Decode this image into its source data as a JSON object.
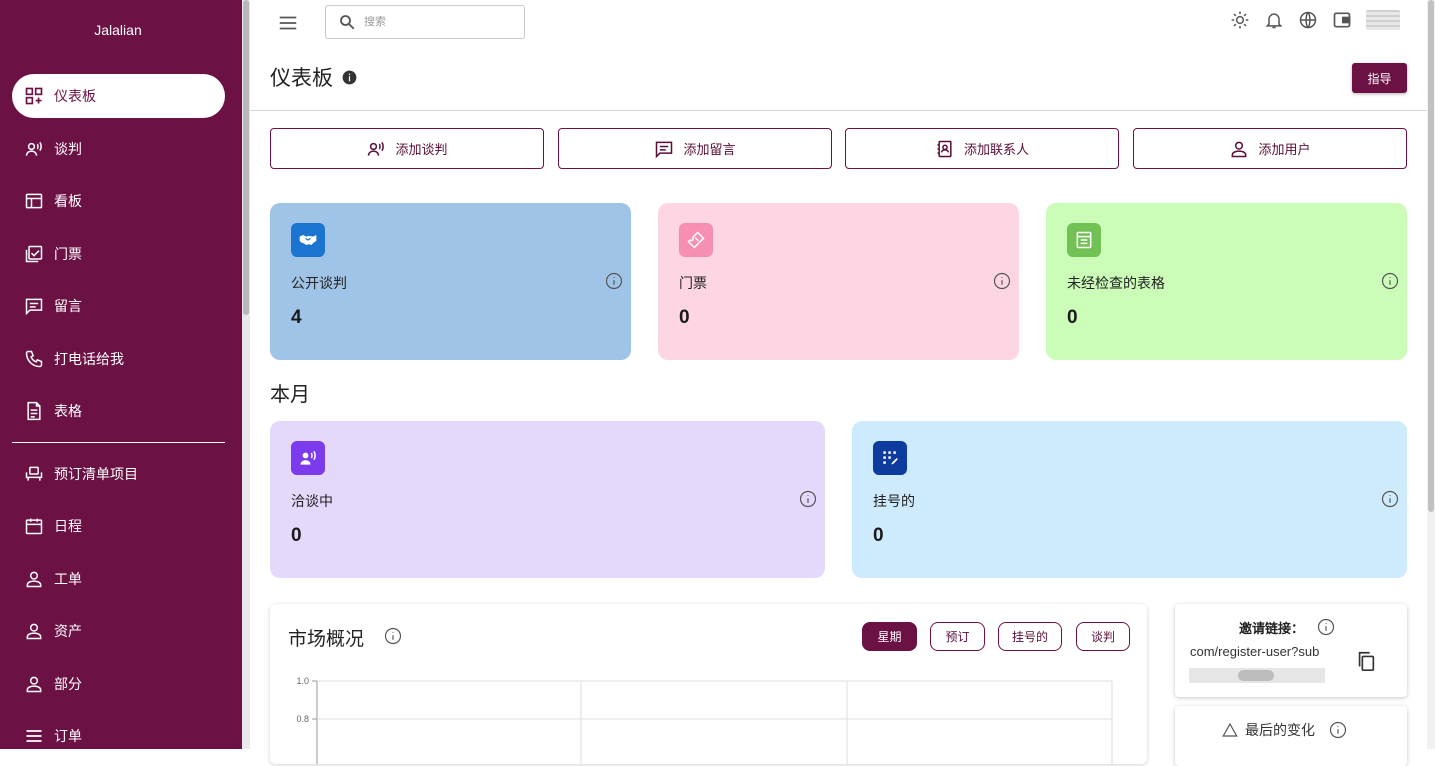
{
  "sidebar": {
    "brand": "Jalalian",
    "items": [
      {
        "label": "仪表板",
        "icon": "dashboard-icon"
      },
      {
        "label": "谈判",
        "icon": "voice-person-icon"
      },
      {
        "label": "看板",
        "icon": "board-icon"
      },
      {
        "label": "门票",
        "icon": "checklist-icon"
      },
      {
        "label": "留言",
        "icon": "message-icon"
      },
      {
        "label": "打电话给我",
        "icon": "phone-icon"
      },
      {
        "label": "表格",
        "icon": "document-icon"
      },
      {
        "label": "预订清单项目",
        "icon": "reservation-icon"
      },
      {
        "label": "日程",
        "icon": "calendar-icon"
      },
      {
        "label": "工单",
        "icon": "person-icon"
      },
      {
        "label": "资产",
        "icon": "person-icon"
      },
      {
        "label": "部分",
        "icon": "person-icon"
      },
      {
        "label": "订单",
        "icon": "list-icon"
      }
    ]
  },
  "topbar": {
    "search_placeholder": "搜索"
  },
  "header": {
    "title": "仪表板",
    "guide_label": "指导"
  },
  "quick_actions": [
    {
      "label": "添加谈判",
      "icon": "voice-person-icon"
    },
    {
      "label": "添加留言",
      "icon": "message-icon"
    },
    {
      "label": "添加联系人",
      "icon": "contact-icon"
    },
    {
      "label": "添加用户",
      "icon": "person-icon"
    }
  ],
  "stats": [
    {
      "label": "公开谈判",
      "value": "4",
      "bg": "#a0c4e7",
      "icon_bg": "#1b75d0",
      "icon": "handshake-icon"
    },
    {
      "label": "门票",
      "value": "0",
      "bg": "#fed6e3",
      "icon_bg": "#f78fb3",
      "icon": "ticket-icon"
    },
    {
      "label": "未经检查的表格",
      "value": "0",
      "bg": "#cbfdb9",
      "icon_bg": "#72c154",
      "icon": "form-icon"
    }
  ],
  "month": {
    "title": "本月",
    "stats": [
      {
        "label": "洽谈中",
        "value": "0",
        "bg": "#e5d9fb",
        "icon_bg": "#7c3aed",
        "icon": "voice-person-icon"
      },
      {
        "label": "挂号的",
        "value": "0",
        "bg": "#cdebfd",
        "icon_bg": "#0d3b9e",
        "icon": "dialpad-icon"
      }
    ]
  },
  "market": {
    "title": "市场概况",
    "tabs": [
      {
        "label": "星期",
        "active": true
      },
      {
        "label": "预订",
        "active": false
      },
      {
        "label": "挂号的",
        "active": false
      },
      {
        "label": "谈判",
        "active": false
      }
    ]
  },
  "chart_data": {
    "type": "line",
    "categories": [],
    "series": [],
    "yticks": [
      "1.0",
      "0.8"
    ],
    "ylim": [
      0,
      1.0
    ],
    "grid": true
  },
  "invite": {
    "title": "邀请链接：",
    "link": "com/register-user?sub"
  },
  "changes": {
    "title": "最后的变化"
  }
}
